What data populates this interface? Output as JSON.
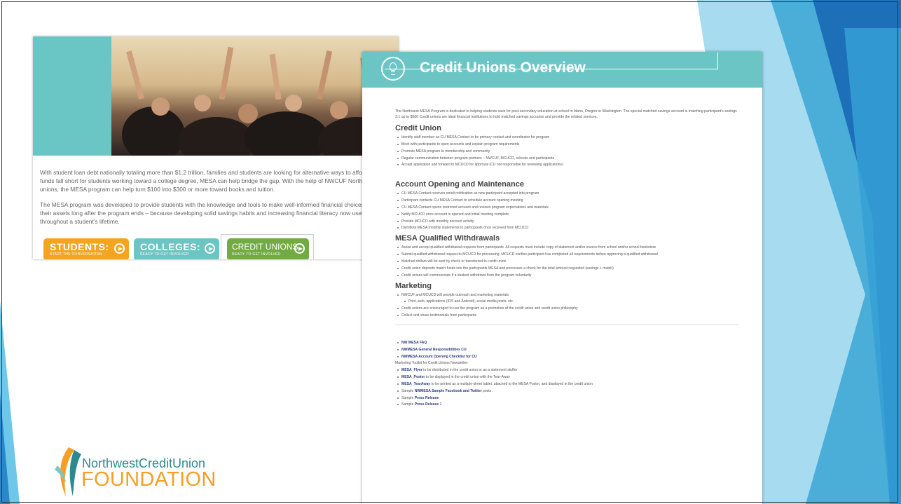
{
  "left_shot": {
    "intro_p1": "With student loan debt nationally totaling more than $1.2 trillion, families and students are looking for alternative ways to affo When funds fall short for students working toward a college degree, MESA can help bridge the gap. With the help of NWCUF Northwest credit unions, the MESA program can help turn $100 into $300 or more toward books and tuition.",
    "intro_p2": "The MESA program was developed to provide students with the knowledge and tools to make well-informed financial choices to build their assets long after the program ends – because developing solid savings habits and increasing financial literacy now useful throughout a student's lifetime.",
    "buttons": [
      {
        "title": "STUDENTS:",
        "sub": "START THE CONVERSATION",
        "color": "#f3a521"
      },
      {
        "title": "COLLEGES:",
        "sub": "READY TO GET INVOLVED",
        "color": "#6cc5c3"
      },
      {
        "title": "CREDIT UNIONS",
        "sub": "READY TO GET INVOLVED",
        "color": "#72aa44"
      }
    ]
  },
  "doc": {
    "title": "Credit Unions Overview",
    "lead": "The Northwest MESA Program is dedicated to helping students save for post-secondary education at school in Idaho, Oregon or Washington. The special matched savings account is matching participant's savings 3:1 up to $500 Credit unions are ideal financial institutions to hold matched savings accounts and provide the related services.",
    "sections": [
      {
        "heading": "Credit Union",
        "items": [
          "Identify staff member as CU MESA Contact to be primary contact and coordinator for program",
          "Meet with participants to open accounts and explain program requirements",
          "Promote MESA program to membership and community",
          "Regular communication between program partners – NWCUF, MCUCD, schools and participants",
          "Accept application and forward to MCUCD for approval (CU not responsible for reviewing applications)"
        ]
      },
      {
        "heading": "Account Opening and Maintenance",
        "items": [
          "CU MESA Contact receives email notification as new participant accepted into program",
          "Participant contacts CU MESA Contact to schedule account opening meeting",
          "CU MESA Contact opens restricted account and reviews program expectations and materials",
          "Notify MCUCD once account is opened and initial meeting complete",
          "Provide MCUCD with monthly account activity",
          "Distribute MESA monthly statements to participants once received from MCUCD"
        ]
      },
      {
        "heading": "MESA Qualified Withdrawals",
        "items": [
          "Assist and accept qualified withdrawal requests from participants. All requests must include copy of statement and/or invoice from school and/or school bookstore",
          "Submit qualified withdrawal request to MCUCD for processing. MCUCD verifies participant has completed all requirements before approving a qualified withdrawal",
          "Matched dollars will be sent by check or transferred to credit union",
          "Credit union deposits match funds into the participants MESA and processes a check for the total amount requested (savings + match)",
          "Credit unions will communicate if a student withdraws from the program voluntarily"
        ]
      },
      {
        "heading": "Marketing",
        "items": [
          "NWCUF and MCUCD will provide outreach and marketing materials",
          "Print, web, applications (IOS and Android), social media posts, etc.",
          "Credit unions are encouraged to use the program as a promotion of the credit union and credit union philosophy",
          "Collect and share testimonials from participants"
        ]
      }
    ],
    "links": [
      "NW MESA FAQ",
      "NWMESA General Responsibilities CU",
      "NWMESA Account Opening Checklist for CU"
    ],
    "toolkit_label": "Marketing Toolkit for Credit Unions Newsletter:",
    "toolkit": [
      {
        "bold": "MESA_Flyer",
        "rest": " to be distributed in the credit union or as a statement stuffer"
      },
      {
        "bold": "MESA_Poster",
        "rest": " to be displayed in the credit union with the Tear-Away"
      },
      {
        "bold": "MESA_TearAway",
        "rest": " to be printed as a multiple-sheet tablet, attached to the MESA Poster, and displayed in the credit union"
      },
      {
        "pre": "Sample ",
        "bold": "NWMESA Sample Facebook and Twitter",
        "rest": " posts"
      },
      {
        "pre": "Sample ",
        "bold": "Press Release",
        "rest": ""
      },
      {
        "pre": "Sample ",
        "bold": "Press Release",
        "rest": " 2"
      }
    ]
  },
  "logo": {
    "line1": "NorthwestCreditUnion",
    "line2": "FOUNDATION"
  },
  "colors": {
    "teal": "#6cc5c5",
    "orange": "#f59f25",
    "blue_deco": "#1d6fb8"
  }
}
